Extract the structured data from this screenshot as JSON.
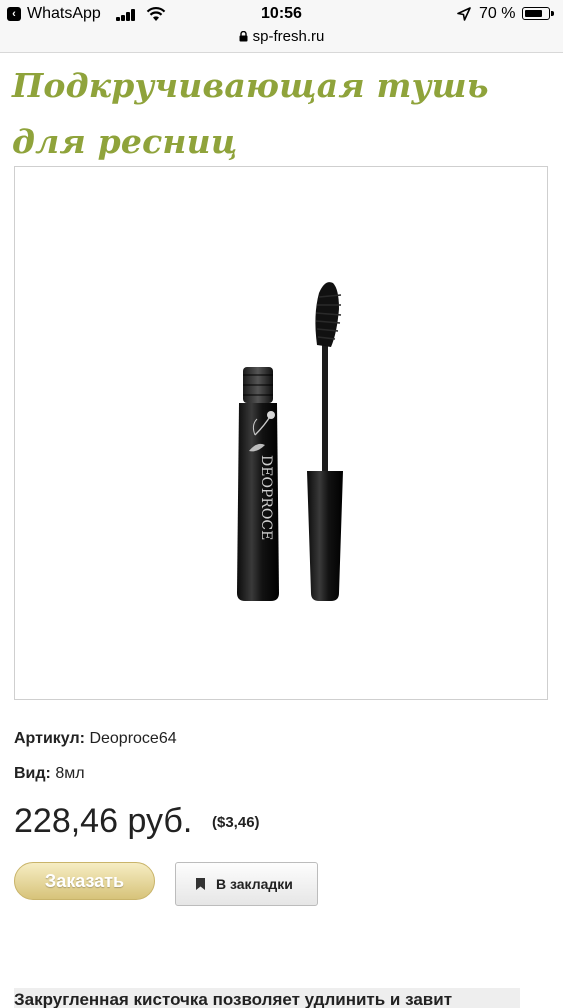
{
  "status_bar": {
    "back_app": "WhatsApp",
    "time": "10:56",
    "battery": "70 %"
  },
  "url_bar": {
    "domain": "sp-fresh.ru"
  },
  "product": {
    "title": "Подкручивающая тушь для ресниц",
    "sku_label": "Артикул:",
    "sku_value": "Deoproce64",
    "type_label": "Вид:",
    "type_value": "8мл",
    "price": "228,46 руб.",
    "price_usd": "($3,46)",
    "brand_on_image": "DEOPROCE"
  },
  "actions": {
    "order_label": "Заказать",
    "bookmark_label": "В закладки"
  },
  "description": {
    "text": "Закругленная кисточка позволяет удлинить и завит"
  },
  "colors": {
    "title": "#8fa33b",
    "order_button": "#d7c37a"
  }
}
